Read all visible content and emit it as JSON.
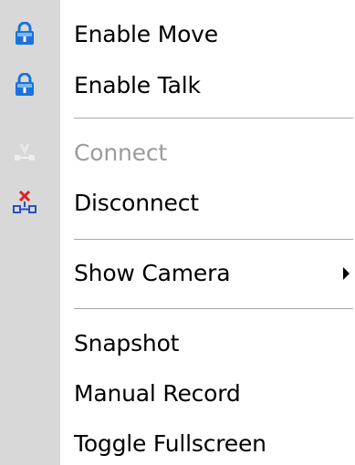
{
  "menu": {
    "items": [
      {
        "label": "Enable Move",
        "icon": "lock-icon",
        "disabled": false
      },
      {
        "label": "Enable Talk",
        "icon": "lock-icon",
        "disabled": false
      },
      {
        "label": "Connect",
        "icon": "connect-icon",
        "disabled": true
      },
      {
        "label": "Disconnect",
        "icon": "disconnect-icon",
        "disabled": false
      },
      {
        "label": "Show Camera",
        "icon": "",
        "disabled": false,
        "has_submenu": true
      },
      {
        "label": "Snapshot",
        "icon": "",
        "disabled": false
      },
      {
        "label": "Manual Record",
        "icon": "",
        "disabled": false
      },
      {
        "label": "Toggle Fullscreen",
        "icon": "",
        "disabled": false
      }
    ]
  },
  "colors": {
    "gutter": "#d8d8d8",
    "lock_blue": "#1a73d9",
    "disconnect_red": "#e02020",
    "disabled_text": "#9b9b9b"
  }
}
